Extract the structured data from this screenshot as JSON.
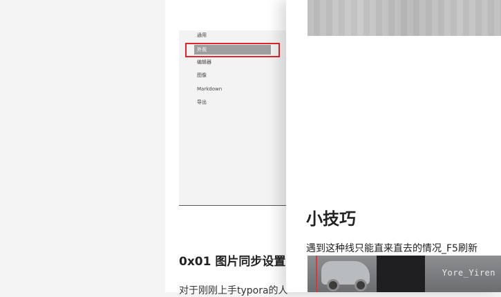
{
  "background_page": {
    "settings_menu": [
      "通用",
      "外观",
      "编辑器",
      "图像",
      "Markdown",
      "导出"
    ],
    "selected_item": "外观",
    "section_title": "0x01 图片同步设置",
    "paragraph_start": "对于刚刚上手typora的人"
  },
  "front_page": {
    "heading": "小技巧",
    "paragraph": "遇到这种线只能直来直去的情况_F5刷新",
    "image_watermark": "Yore_Yiren"
  },
  "colors": {
    "highlight_border": "#e0262b",
    "selected_menu_bg": "#9e9e9e"
  }
}
